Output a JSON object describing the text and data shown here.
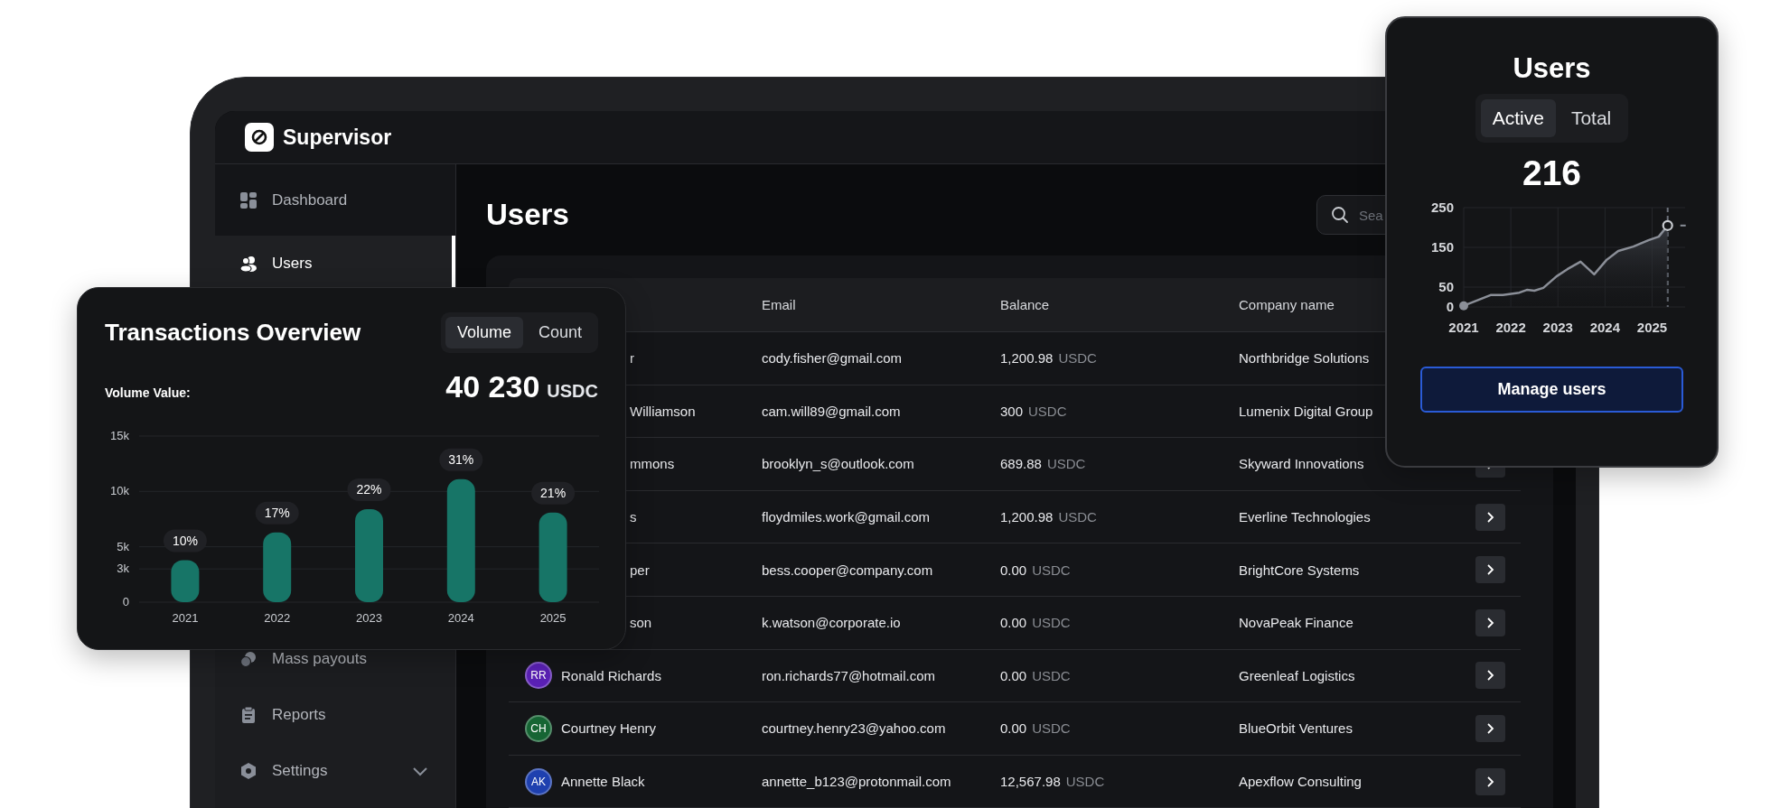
{
  "app": {
    "name": "Supervisor"
  },
  "sidebar": {
    "items": [
      {
        "label": "Dashboard",
        "kind": "grid",
        "selected": false
      },
      {
        "label": "Users",
        "kind": "users",
        "selected": true
      },
      {
        "label": "Mass payouts",
        "kind": "coins",
        "selected": false
      },
      {
        "label": "Reports",
        "kind": "clipboard",
        "selected": false
      },
      {
        "label": "Settings",
        "kind": "hexagon",
        "selected": false,
        "expanded": false
      }
    ]
  },
  "page": {
    "title": "Users",
    "search": {
      "placeholder": "Sea"
    }
  },
  "table": {
    "columns": [
      "Email",
      "Balance",
      "Company name"
    ],
    "rows": [
      {
        "name": "r",
        "email": "cody.fisher@gmail.com",
        "amount": "1,200.98",
        "currency": "USDC",
        "company": "Northbridge Solutions"
      },
      {
        "name": "Williamson",
        "email": "cam.will89@gmail.com",
        "amount": "300",
        "currency": "USDC",
        "company": "Lumenix Digital Group"
      },
      {
        "name": "mmons",
        "email": "brooklyn_s@outlook.com",
        "amount": "689.88",
        "currency": "USDC",
        "company": "Skyward Innovations"
      },
      {
        "name": "s",
        "email": "floydmiles.work@gmail.com",
        "amount": "1,200.98",
        "currency": "USDC",
        "company": "Everline Technologies"
      },
      {
        "name": "per",
        "email": "bess.cooper@company.com",
        "amount": "0.00",
        "currency": "USDC",
        "company": "BrightCore Systems"
      },
      {
        "name": "son",
        "email": "k.watson@corporate.io",
        "amount": "0.00",
        "currency": "USDC",
        "company": "NovaPeak Finance"
      },
      {
        "name": "Ronald Richards",
        "initials": "RR",
        "color": "#5b21b6",
        "email": "ron.richards77@hotmail.com",
        "amount": "0.00",
        "currency": "USDC",
        "company": "Greenleaf Logistics"
      },
      {
        "name": "Courtney Henry",
        "initials": "CH",
        "color": "#166534",
        "email": "courtney.henry23@yahoo.com",
        "amount": "0.00",
        "currency": "USDC",
        "company": "BlueOrbit Ventures"
      },
      {
        "name": "Annette Black",
        "initials": "AK",
        "color": "#1e40af",
        "email": "annette_b123@protonmail.com",
        "amount": "12,567.98",
        "currency": "USDC",
        "company": "Apexflow Consulting"
      }
    ]
  },
  "transactions_card": {
    "title": "Transactions Overview",
    "tabs": [
      {
        "label": "Volume",
        "selected": true
      },
      {
        "label": "Count",
        "selected": false
      }
    ],
    "value_label": "Volume Value:",
    "value": "40 230",
    "unit": "USDC",
    "chart_data": {
      "type": "bar",
      "categories": [
        "2021",
        "2022",
        "2023",
        "2024",
        "2025"
      ],
      "values": [
        3800,
        6300,
        8400,
        11100,
        8100
      ],
      "ylim": [
        0,
        15000
      ],
      "grid": true,
      "yticks": [
        {
          "value": 0,
          "label": "0"
        },
        {
          "value": 3000,
          "label": "3k"
        },
        {
          "value": 5000,
          "label": "5k"
        },
        {
          "value": 10000,
          "label": "10k"
        },
        {
          "value": 15000,
          "label": "15k"
        }
      ],
      "annotations": [
        "10%",
        "17%",
        "22%",
        "31%",
        "21%"
      ]
    }
  },
  "users_card": {
    "title": "Users",
    "tabs": [
      {
        "label": "Active",
        "selected": true
      },
      {
        "label": "Total",
        "selected": false
      }
    ],
    "value": "216",
    "chart_data": {
      "type": "area",
      "x": [
        2021,
        2021.57,
        2021.83,
        2022.18,
        2022.34,
        2022.5,
        2022.69,
        2022.97,
        2023.2,
        2023.48,
        2023.77,
        2024.03,
        2024.28,
        2024.6,
        2024.92,
        2025.14,
        2025.33
      ],
      "series": [
        {
          "color": "#8b8f98",
          "values": [
            3,
            30,
            30,
            36,
            43,
            41,
            48,
            77,
            95,
            114,
            82,
            118,
            141,
            152,
            168,
            177,
            205
          ]
        }
      ],
      "xlim": [
        2021,
        2025.7
      ],
      "ylim": [
        0,
        250
      ],
      "grid": true,
      "ref_lines": [
        {
          "axis": "x",
          "value": 2025.33
        }
      ],
      "xticks": [
        2021,
        2022,
        2023,
        2024,
        2025
      ],
      "yticks": [
        0,
        50,
        150,
        250
      ]
    },
    "button": "Manage users"
  }
}
